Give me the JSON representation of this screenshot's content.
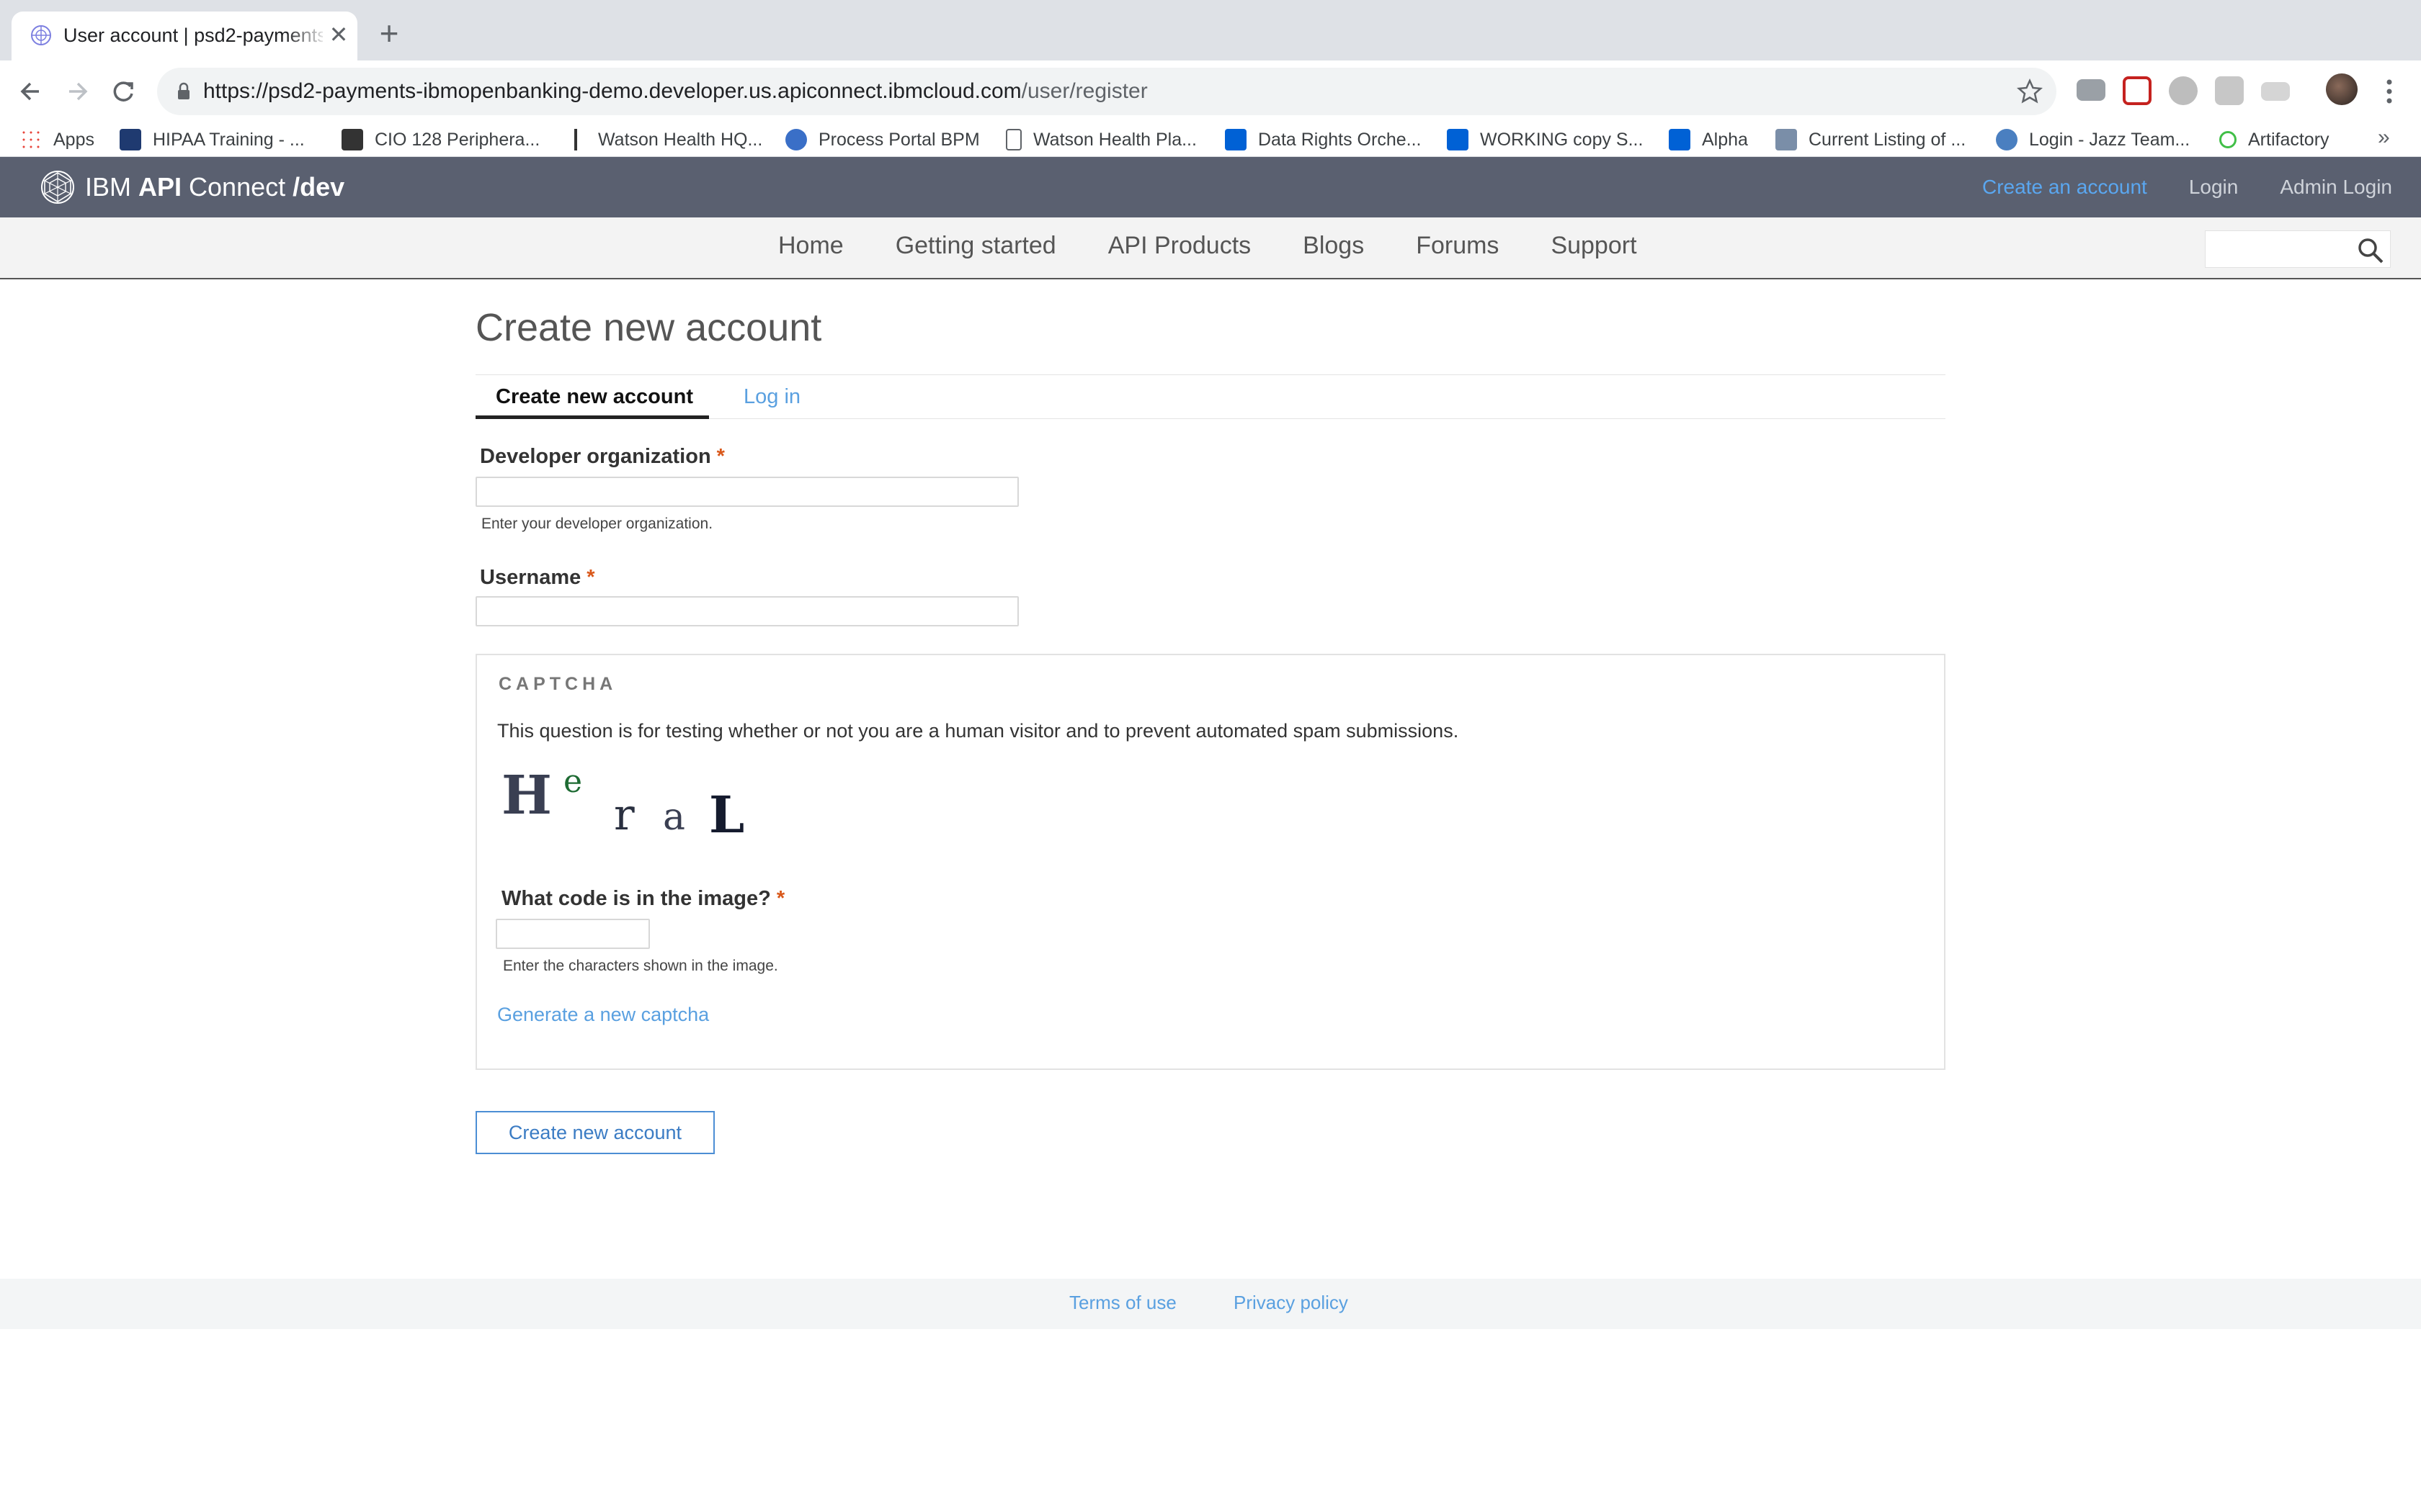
{
  "browser": {
    "tab_title": "User account | psd2-payments",
    "new_tab_symbol": "+",
    "close_symbol": "✕",
    "url_host": "https://psd2-payments-ibmopenbanking-demo.developer.us.apiconnect.ibmcloud.com",
    "url_path": "/user/register",
    "bookmarks": [
      {
        "label": "Apps",
        "icon": "apps-grid-icon"
      },
      {
        "label": "HIPAA Training - ...",
        "icon": "hipaa-icon"
      },
      {
        "label": "CIO 128 Periphera...",
        "icon": "w3-icon"
      },
      {
        "label": "Watson Health HQ...",
        "icon": "watson-icon"
      },
      {
        "label": "Process Portal BPM",
        "icon": "gear-icon"
      },
      {
        "label": "Watson Health Pla...",
        "icon": "page-icon"
      },
      {
        "label": "Data Rights Orche...",
        "icon": "box-icon"
      },
      {
        "label": "WORKING copy S...",
        "icon": "box-icon"
      },
      {
        "label": "Alpha",
        "icon": "box-icon"
      },
      {
        "label": "Current Listing of ...",
        "icon": "listing-icon"
      },
      {
        "label": "Login - Jazz Team...",
        "icon": "jazz-icon"
      },
      {
        "label": "Artifactory",
        "icon": "artifactory-icon"
      }
    ],
    "more_symbol": "»"
  },
  "site": {
    "brand_prefix": "IBM",
    "brand_bold": "API",
    "brand_name": "Connect",
    "brand_suffix": "/dev",
    "header_links": {
      "create_account": "Create an account",
      "login": "Login",
      "admin_login": "Admin Login"
    },
    "nav": [
      "Home",
      "Getting started",
      "API Products",
      "Blogs",
      "Forums",
      "Support"
    ],
    "search_value": ""
  },
  "page": {
    "title": "Create new account",
    "tabs": [
      {
        "label": "Create new account",
        "active": true
      },
      {
        "label": "Log in",
        "active": false
      }
    ],
    "fields": {
      "org_label": "Developer organization",
      "org_value": "",
      "org_help": "Enter your developer organization.",
      "username_label": "Username",
      "username_value": "",
      "required_mark": "*"
    },
    "captcha": {
      "legend": "CAPTCHA",
      "description": "This question is for testing whether or not you are a human visitor and to prevent automated spam submissions.",
      "image_text": "HeraL",
      "code_label": "What code is in the image?",
      "code_value": "",
      "code_help": "Enter the characters shown in the image.",
      "new_captcha_link": "Generate a new captcha"
    },
    "submit_label": "Create new account"
  },
  "footer": {
    "terms": "Terms of use",
    "privacy": "Privacy policy"
  },
  "colors": {
    "header_bg": "#5a6070",
    "link": "#5aa0e0",
    "required": "#d9581a",
    "button_border": "#4c8ed4"
  }
}
